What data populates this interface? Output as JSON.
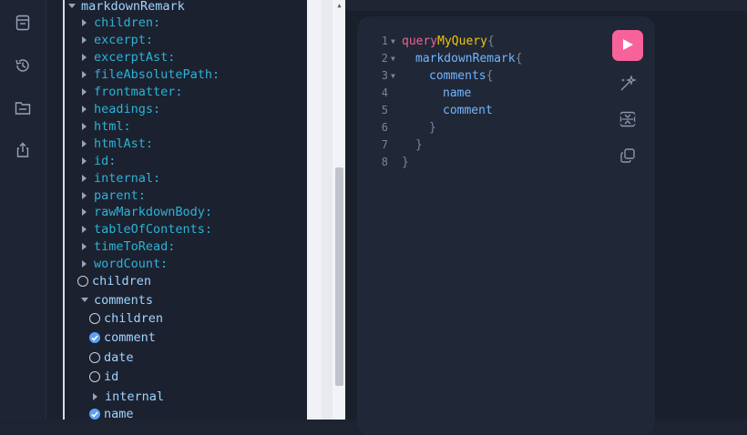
{
  "rail": {
    "icons": [
      "document-icon",
      "history-icon",
      "folder-icon",
      "share-icon"
    ]
  },
  "explorer": {
    "root_label": "markdownRemark",
    "fields": [
      "children:",
      "excerpt:",
      "excerptAst:",
      "fileAbsolutePath:",
      "frontmatter:",
      "headings:",
      "html:",
      "htmlAst:",
      "id:",
      "internal:",
      "parent:",
      "rawMarkdownBody:",
      "tableOfContents:",
      "timeToRead:",
      "wordCount:"
    ],
    "children_label": "children",
    "comments_label": "comments",
    "comments_items": [
      {
        "label": "children",
        "checked": false,
        "kind": "checkbox"
      },
      {
        "label": "comment",
        "checked": true,
        "kind": "checkbox"
      },
      {
        "label": "date",
        "checked": false,
        "kind": "checkbox"
      },
      {
        "label": "id",
        "checked": false,
        "kind": "checkbox"
      },
      {
        "label": "internal",
        "checked": false,
        "kind": "caret"
      },
      {
        "label": "name",
        "checked": true,
        "kind": "checkbox"
      }
    ]
  },
  "editor": {
    "line_numbers": [
      "1",
      "2",
      "3",
      "4",
      "5",
      "6",
      "7",
      "8"
    ],
    "code": {
      "keyword": "query",
      "query_name": "MyQuery",
      "root_field": "markdownRemark",
      "comments_field": "comments",
      "name_field": "name",
      "comment_field": "comment",
      "open_brace": "{",
      "close_brace": "}"
    }
  },
  "toolbar": {
    "icons": [
      "run-icon",
      "prettify-icon",
      "merge-icon",
      "copy-icon"
    ],
    "accent": "#f7629a"
  }
}
